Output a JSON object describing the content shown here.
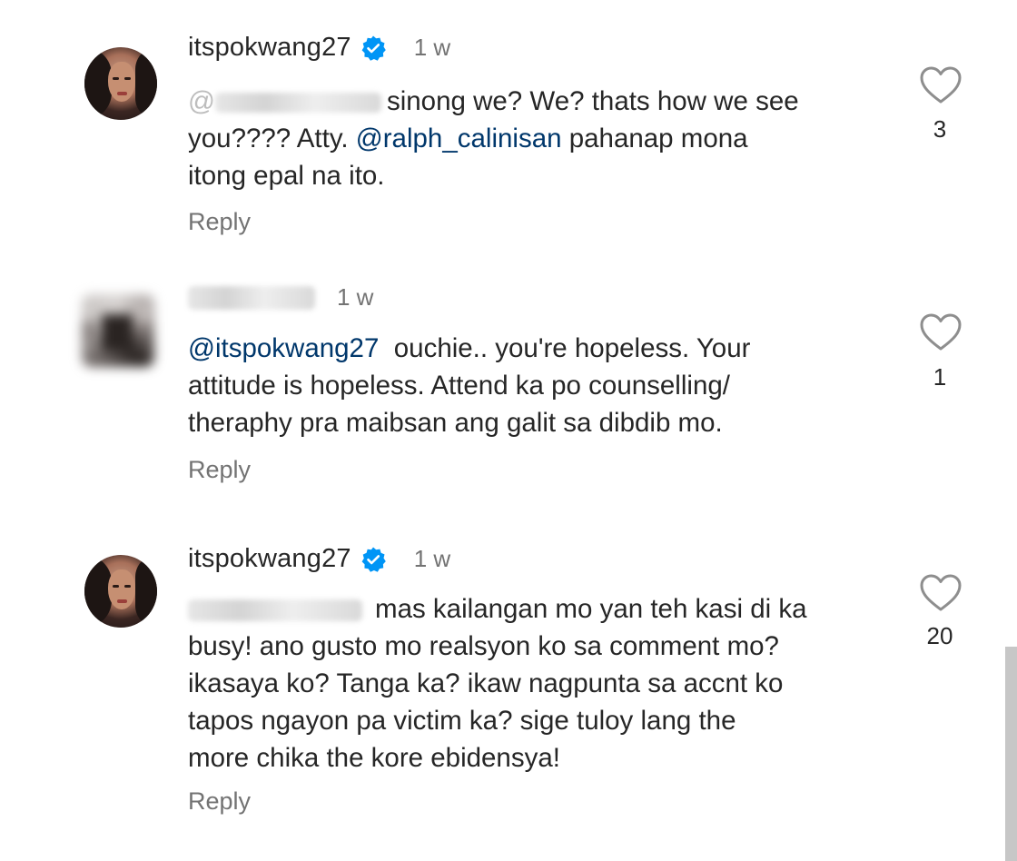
{
  "comments": [
    {
      "username": "itspokwang27",
      "verified": true,
      "time": "1 w",
      "text_lines": [
        "sinong we? We? thats how we see",
        "you???? Atty. ",
        "@ralph_calinisan",
        " pahanap mona",
        "itong epal na ito."
      ],
      "reply_label": "Reply",
      "like_count": "3",
      "mention_prefix": "@",
      "mention_prefix_redacted": true
    },
    {
      "username_redacted": true,
      "time": "1 w",
      "text_lines": [
        "@itspokwang27",
        "  ouchie.. you're hopeless. Your",
        "attitude is hopeless. Attend ka po counselling/",
        "theraphy pra maibsan ang galit sa dibdib mo."
      ],
      "reply_label": "Reply",
      "like_count": "1"
    },
    {
      "username": "itspokwang27",
      "verified": true,
      "time": "1 w",
      "text_lines": [
        "mas kailangan mo yan teh kasi di ka",
        "busy! ano gusto mo realsyon ko sa comment mo?",
        "ikasaya ko? Tanga ka? ikaw nagpunta sa accnt ko",
        "tapos ngayon pa victim ka? sige tuloy lang the",
        "more chika the kore ebidensya!"
      ],
      "reply_label": "Reply",
      "like_count": "20"
    }
  ],
  "icons": {
    "like": "heart-outline-icon",
    "verified": "verified-badge-icon"
  },
  "colors": {
    "text": "#262626",
    "muted": "#737373",
    "mention": "#00376b",
    "verified": "#0095f6"
  }
}
